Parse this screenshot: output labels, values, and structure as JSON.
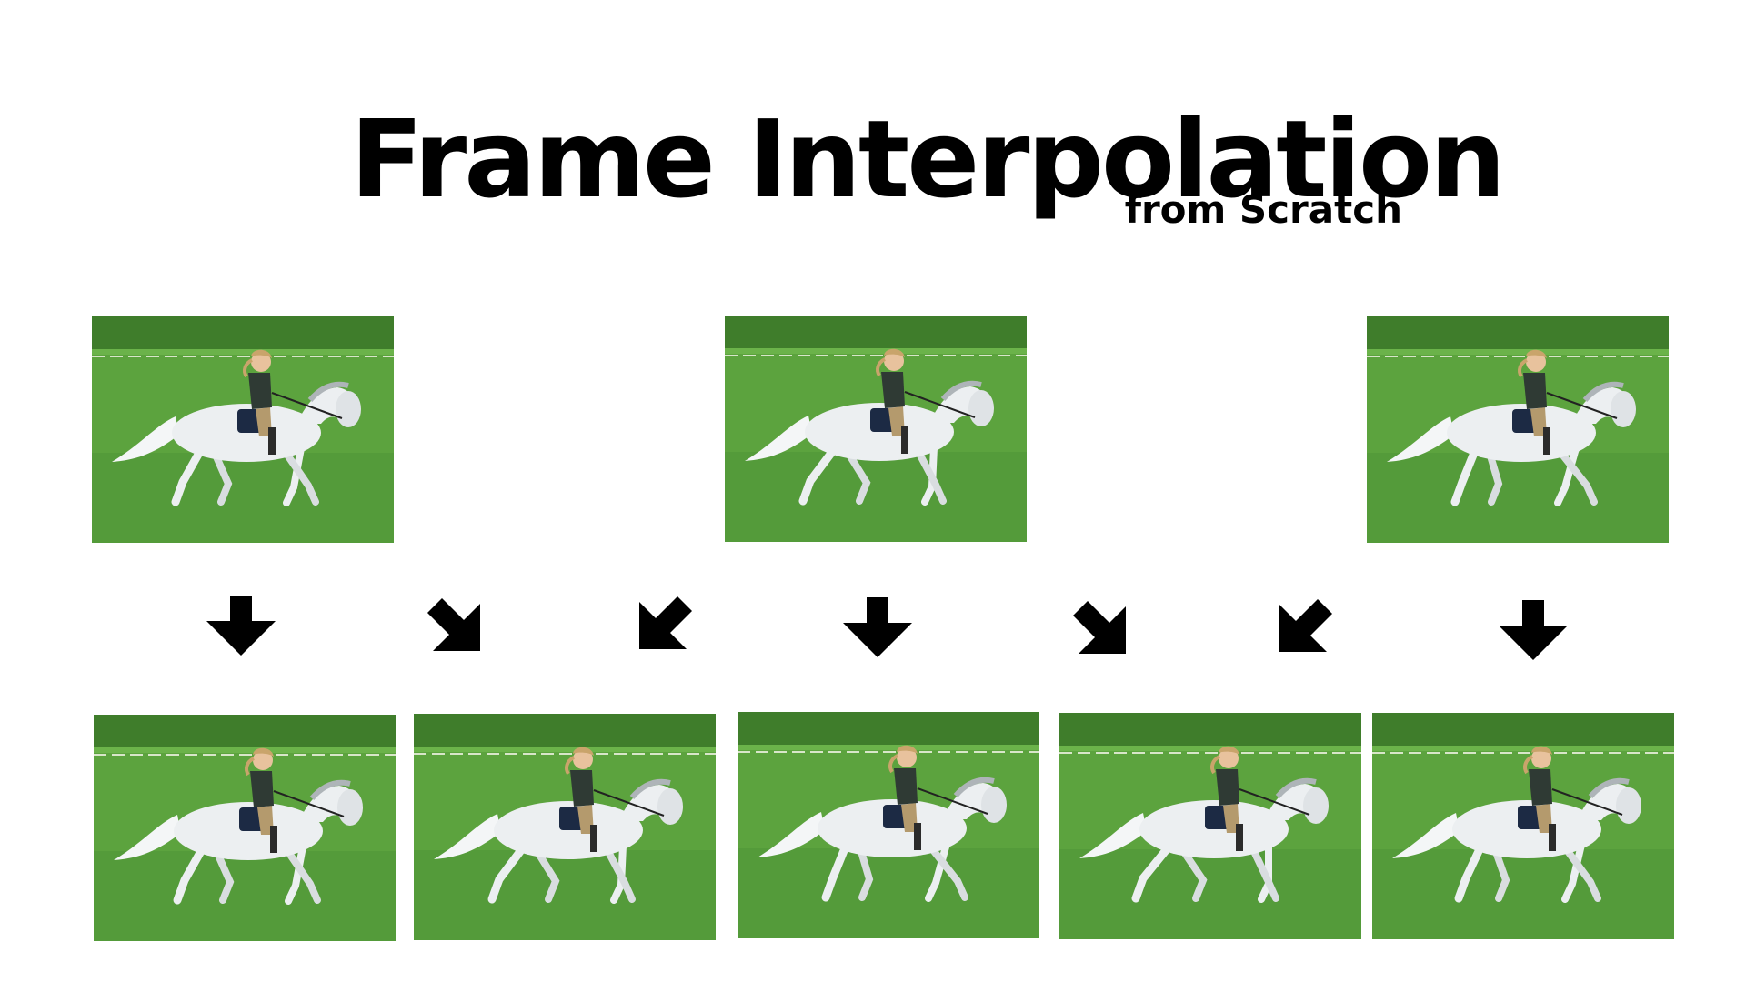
{
  "header": {
    "title": "Frame Interpolation",
    "subtitle": "from Scratch"
  },
  "colors": {
    "background": "#ffffff",
    "grass": "#5ca33e",
    "grass_dark": "#3f7d2b",
    "horse": "#eceff1",
    "arrow": "#000000"
  },
  "rows": {
    "input_frames": [
      {
        "role": "input",
        "pose": 0
      },
      {
        "role": "input",
        "pose": 1
      },
      {
        "role": "input",
        "pose": 2
      }
    ],
    "output_frames": [
      {
        "role": "original",
        "pose": 0
      },
      {
        "role": "interpolated",
        "pose": 1
      },
      {
        "role": "original",
        "pose": 2
      },
      {
        "role": "interpolated",
        "pose": 3
      },
      {
        "role": "original",
        "pose": 4
      }
    ],
    "arrows": [
      {
        "icon": "arrow-down-icon",
        "direction": "down"
      },
      {
        "icon": "arrow-down-right-icon",
        "direction": "down-right"
      },
      {
        "icon": "arrow-down-left-icon",
        "direction": "down-left"
      },
      {
        "icon": "arrow-down-icon",
        "direction": "down"
      },
      {
        "icon": "arrow-down-right-icon",
        "direction": "down-right"
      },
      {
        "icon": "arrow-down-left-icon",
        "direction": "down-left"
      },
      {
        "icon": "arrow-down-icon",
        "direction": "down"
      }
    ]
  }
}
